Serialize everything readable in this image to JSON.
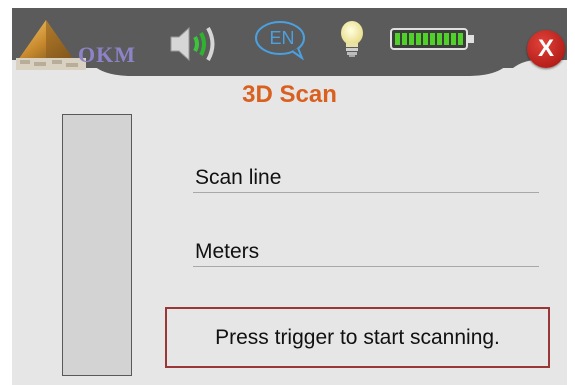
{
  "header": {
    "brand": "OKM",
    "language": "EN",
    "icons": {
      "logo": "okm-pyramid-logo",
      "volume": "speaker-volume-icon",
      "language": "language-speech-bubble-icon",
      "light": "light-bulb-icon",
      "battery": "battery-full-icon",
      "close": "close-icon"
    },
    "close_label": "X",
    "battery_level": 1.0
  },
  "main": {
    "title": "3D Scan",
    "fields": [
      {
        "label": "Scan line"
      },
      {
        "label": "Meters"
      }
    ],
    "message": "Press trigger to start scanning."
  },
  "colors": {
    "header_bg": "#5b5b5b",
    "title": "#d9601e",
    "close_button": "#c52a23",
    "message_border": "#9a3636",
    "battery": "#4fd12a"
  }
}
